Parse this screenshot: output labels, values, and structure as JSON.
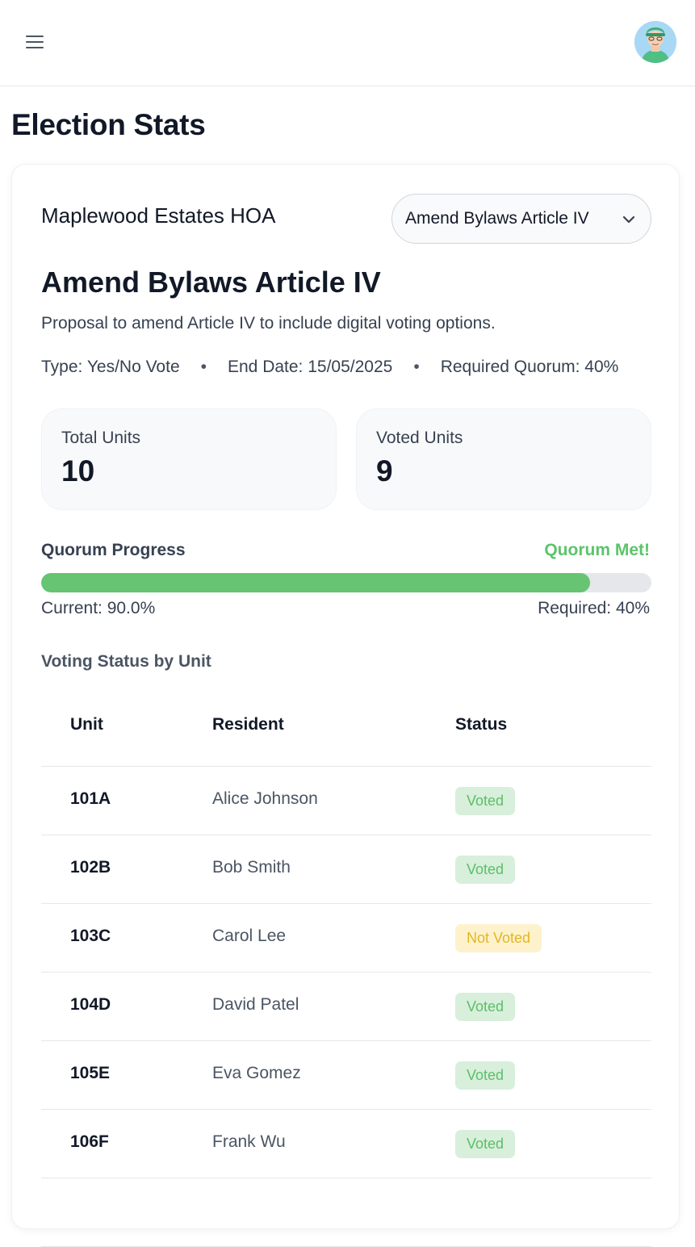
{
  "header": {
    "menu_icon": "hamburger-menu-icon",
    "avatar_icon": "user-avatar"
  },
  "page": {
    "title": "Election Stats"
  },
  "election": {
    "hoa_name": "Maplewood Estates HOA",
    "selected": "Amend Bylaws Article IV",
    "title": "Amend Bylaws Article IV",
    "description": "Proposal to amend Article IV to include digital voting options.",
    "type": "Type: Yes/No Vote",
    "end_date": "End Date: 15/05/2025",
    "required_quorum": "Required Quorum: 40%",
    "separator": "•"
  },
  "stats": {
    "total_label": "Total Units",
    "total_value": "10",
    "voted_label": "Voted Units",
    "voted_value": "9"
  },
  "quorum": {
    "label": "Quorum Progress",
    "status": "Quorum Met!",
    "progress_percent": 90,
    "current": "Current: 90.0%",
    "required": "Required: 40%"
  },
  "voting_table": {
    "title": "Voting Status by Unit",
    "headers": {
      "unit": "Unit",
      "resident": "Resident",
      "status": "Status"
    },
    "rows": [
      {
        "unit": "101A",
        "resident": "Alice Johnson",
        "status": "Voted",
        "voted": true
      },
      {
        "unit": "102B",
        "resident": "Bob Smith",
        "status": "Voted",
        "voted": true
      },
      {
        "unit": "103C",
        "resident": "Carol Lee",
        "status": "Not Voted",
        "voted": false
      },
      {
        "unit": "104D",
        "resident": "David Patel",
        "status": "Voted",
        "voted": true
      },
      {
        "unit": "105E",
        "resident": "Eva Gomez",
        "status": "Voted",
        "voted": true
      },
      {
        "unit": "106F",
        "resident": "Frank Wu",
        "status": "Voted",
        "voted": true
      }
    ]
  },
  "colors": {
    "accent_green": "#5cc46a",
    "progress_fill": "#66c472",
    "voted_badge_bg": "#d8efdb",
    "not_voted_badge_bg": "#fdf2cc",
    "not_voted_text": "#e6b521"
  }
}
